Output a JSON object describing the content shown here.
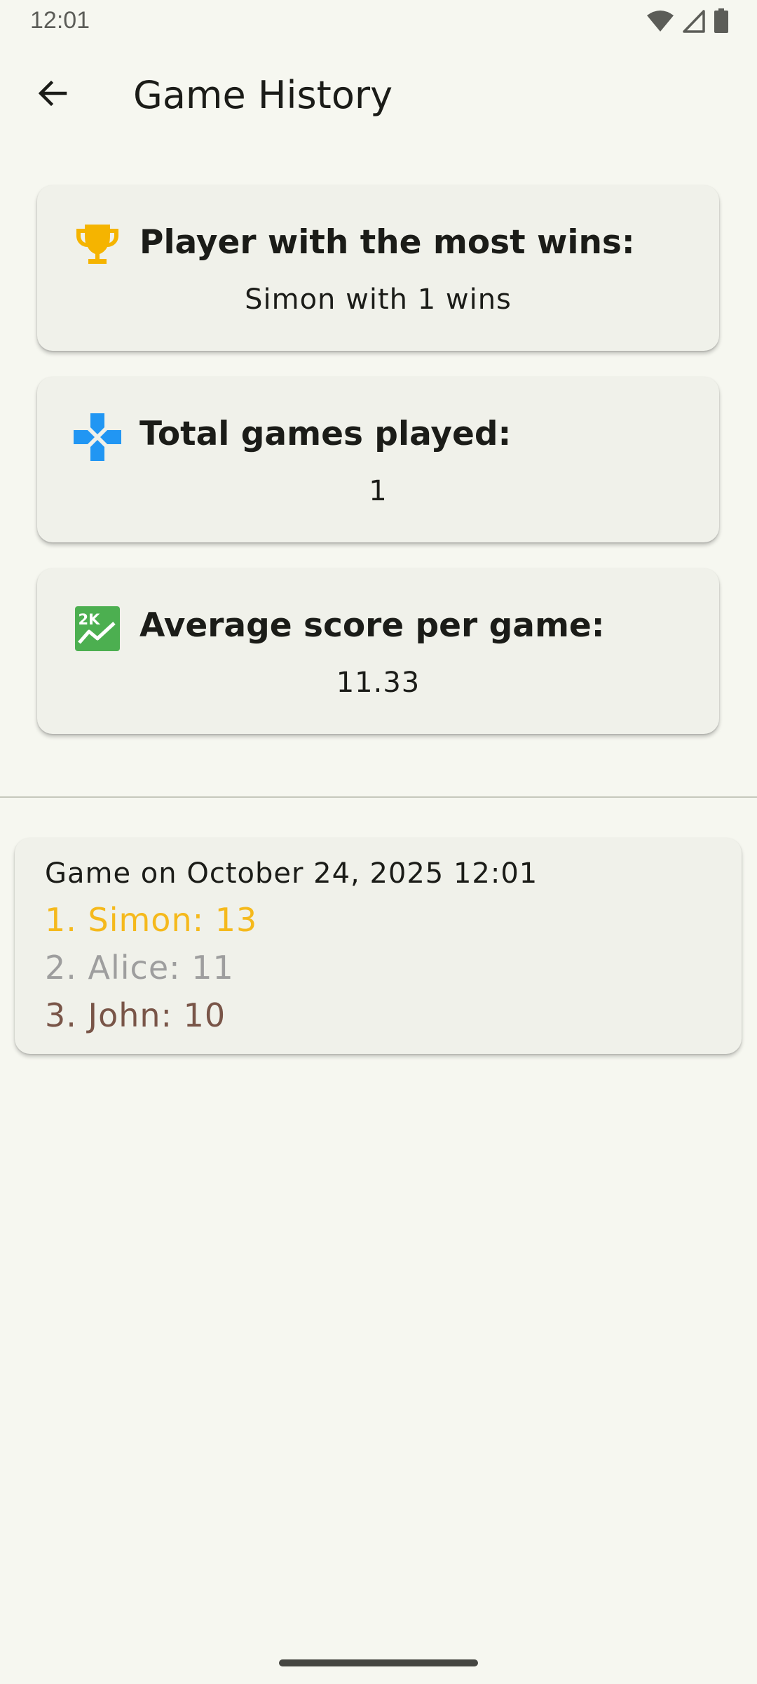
{
  "status_bar": {
    "time": "12:01",
    "icons": [
      "wifi-icon",
      "signal-icon",
      "battery-icon"
    ]
  },
  "app_bar": {
    "back_icon": "arrow-back-icon",
    "title": "Game History"
  },
  "stats": {
    "most_wins": {
      "icon": "trophy-icon",
      "label": "Player with the most wins:",
      "value": "Simon with 1 wins"
    },
    "total_games": {
      "icon": "gamepad-icon",
      "label": "Total games played:",
      "value": "1"
    },
    "average_score": {
      "icon": "score-chart-icon",
      "icon_text": "2K",
      "label": "Average score per game:",
      "value": "11.33"
    }
  },
  "games": [
    {
      "title": "Game on October 24, 2025 12:01",
      "results": [
        "1. Simon: 13",
        "2. Alice: 11",
        "3. John: 10"
      ]
    }
  ],
  "colors": {
    "background": "#f6f7f0",
    "card": "#f0f1ea",
    "trophy": "#f5b400",
    "gamepad": "#2196f3",
    "score": "#4caf50",
    "first_place": "#f5b91c",
    "second_place": "#9e9e9e",
    "third_place": "#795548"
  }
}
